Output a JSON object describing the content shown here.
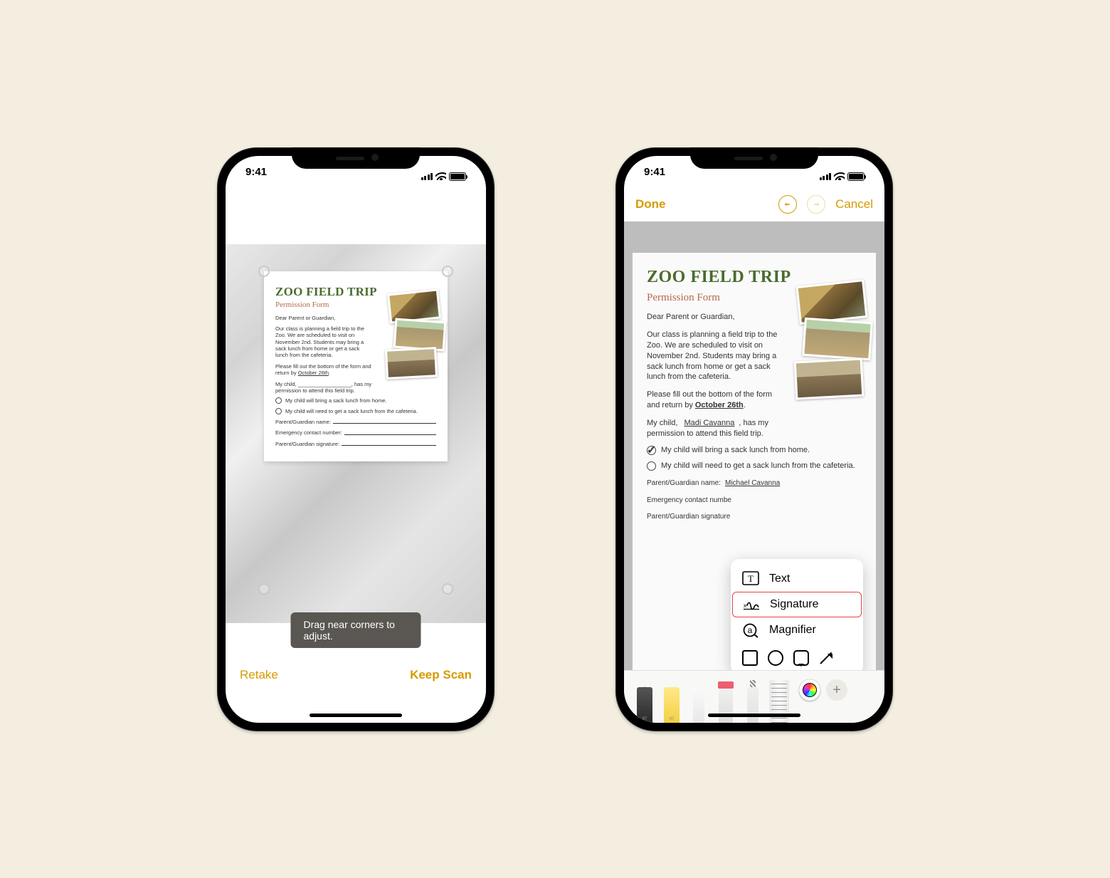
{
  "status": {
    "time": "9:41"
  },
  "phone1": {
    "toast": "Drag near corners to adjust.",
    "retake": "Retake",
    "keep": "Keep Scan",
    "doc": {
      "title": "ZOO FIELD TRIP",
      "subtitle": "Permission Form",
      "greeting": "Dear Parent or Guardian,",
      "body1": "Our class is planning a field trip to the Zoo. We are scheduled to visit on November 2nd. Students may bring a sack lunch from home or get a sack lunch from the cafeteria.",
      "body2_a": "Please fill out the bottom of the form and return by ",
      "body2_b": "October 26th",
      "body2_c": ".",
      "child_a": "My child, ",
      "child_b": ", has my permission to attend this field trip.",
      "opt1": "My child will bring a sack lunch from home.",
      "opt2": "My child will need to get a sack lunch from the cafeteria.",
      "f1": "Parent/Guardian name:",
      "f2": "Emergency contact number:",
      "f3": "Parent/Guardian signature:"
    }
  },
  "phone2": {
    "done": "Done",
    "cancel": "Cancel",
    "doc": {
      "title": "ZOO FIELD TRIP",
      "subtitle": "Permission Form",
      "greeting": "Dear Parent or Guardian,",
      "body1": "Our class is planning a field trip to the Zoo. We are scheduled to visit on November 2nd. Students may bring a sack lunch from home or get a sack lunch from the cafeteria.",
      "body2_a": "Please fill out the bottom of the form and return by ",
      "body2_b": "October 26th",
      "body2_c": ".",
      "child_a": "My child, ",
      "child_name": "Madi Cavanna",
      "child_b": ", has my permission to attend this field trip.",
      "opt1": "My child will bring a sack lunch from home.",
      "opt2": "My child will need to get a sack lunch from the cafeteria.",
      "f1": "Parent/Guardian name:",
      "f1_val": "Michael Cavanna",
      "f2": "Emergency contact numbe",
      "f3": "Parent/Guardian signature"
    },
    "popover": {
      "text": "Text",
      "signature": "Signature",
      "magnifier": "Magnifier"
    },
    "tool_labels": {
      "pen": "97",
      "hl": "80"
    }
  }
}
